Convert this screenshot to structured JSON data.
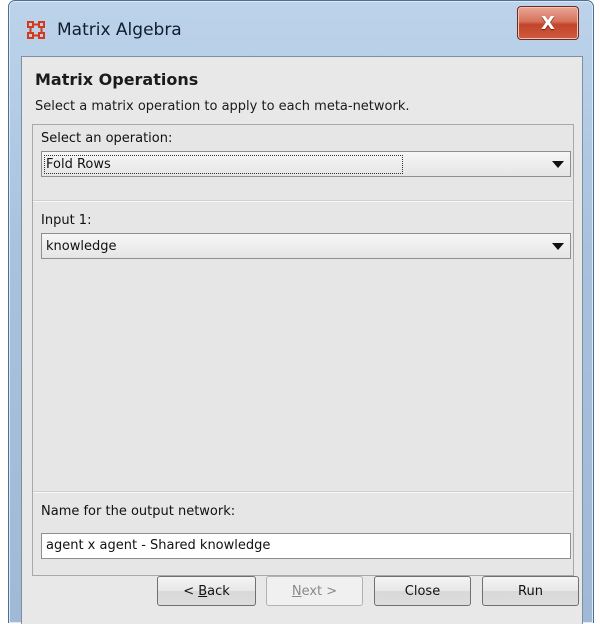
{
  "window": {
    "title": "Matrix Algebra",
    "close_label": "X"
  },
  "header": {
    "title": "Matrix Operations",
    "subtitle": "Select a matrix operation to apply to each meta-network."
  },
  "operation": {
    "label": "Select an operation:",
    "selected": "Fold Rows"
  },
  "input1": {
    "label": "Input 1:",
    "selected": "knowledge"
  },
  "output": {
    "label": "Name for the output network:",
    "value": "agent x agent - Shared knowledge"
  },
  "buttons": {
    "back_prefix": "< ",
    "back_mnemonic": "B",
    "back_rest": "ack",
    "next_mnemonic": "N",
    "next_rest": "ext >",
    "close": "Close",
    "run": "Run"
  },
  "colors": {
    "frame": "#a8c2de",
    "close_button": "#c2452a",
    "client": "#e8e8e8"
  }
}
